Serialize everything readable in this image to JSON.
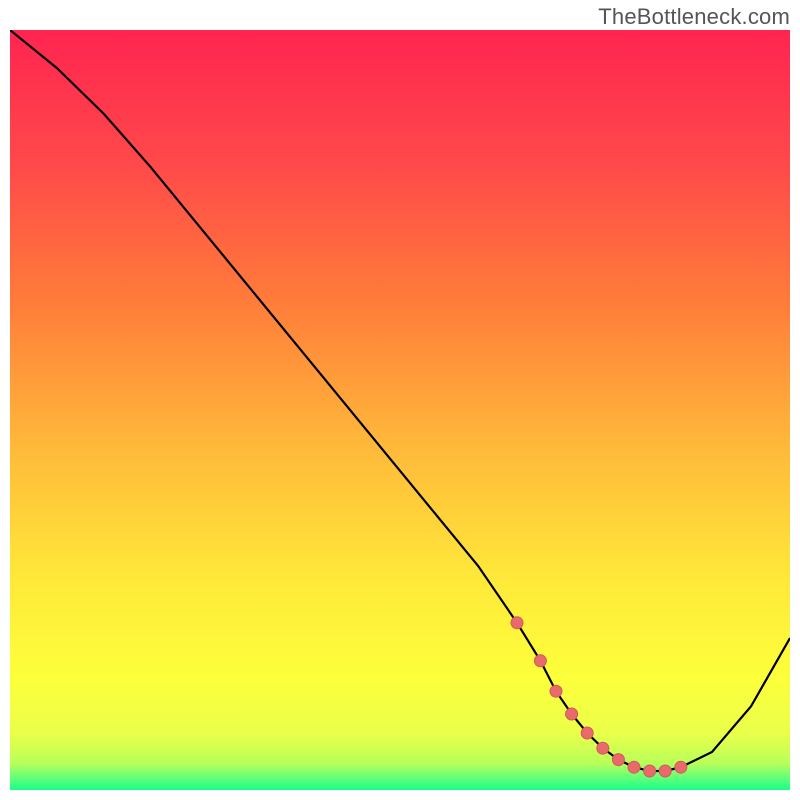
{
  "watermark": "TheBottleneck.com",
  "colors": {
    "curve_stroke": "#000000",
    "marker_fill": "#e86a6a",
    "marker_stroke": "#d35a5a",
    "gradient_stops": [
      {
        "offset": "0%",
        "color": "#ff2450"
      },
      {
        "offset": "18%",
        "color": "#ff4a4a"
      },
      {
        "offset": "35%",
        "color": "#ff7a3a"
      },
      {
        "offset": "55%",
        "color": "#ffb93a"
      },
      {
        "offset": "72%",
        "color": "#ffe83a"
      },
      {
        "offset": "85%",
        "color": "#fdff3a"
      },
      {
        "offset": "92.5%",
        "color": "#eaff4a"
      },
      {
        "offset": "96.5%",
        "color": "#b8ff5a"
      },
      {
        "offset": "98.5%",
        "color": "#5eff7a"
      },
      {
        "offset": "100%",
        "color": "#18ff8a"
      }
    ]
  },
  "chart_data": {
    "type": "line",
    "title": "",
    "xlabel": "",
    "ylabel": "",
    "xlim": [
      0,
      100
    ],
    "ylim": [
      0,
      100
    ],
    "grid": false,
    "legend": false,
    "annotations": [],
    "series": [
      {
        "name": "bottleneck-curve",
        "x": [
          0,
          6,
          12,
          18,
          24,
          30,
          36,
          42,
          48,
          54,
          60,
          65,
          68,
          70,
          72,
          74,
          76,
          78,
          80,
          82,
          84,
          86,
          90,
          95,
          100
        ],
        "values": [
          100,
          95,
          89,
          82,
          74.5,
          67,
          59.5,
          52,
          44.5,
          37,
          29.5,
          22,
          17,
          13,
          10,
          7.5,
          5.5,
          4,
          3,
          2.5,
          2.5,
          3,
          5,
          11,
          20
        ]
      }
    ],
    "markers": {
      "name": "highlighted-range",
      "x": [
        65,
        68,
        70,
        72,
        74,
        76,
        78,
        80,
        82,
        84,
        86
      ],
      "values": [
        22,
        17,
        13,
        10,
        7.5,
        5.5,
        4,
        3,
        2.5,
        2.5,
        3
      ]
    }
  }
}
